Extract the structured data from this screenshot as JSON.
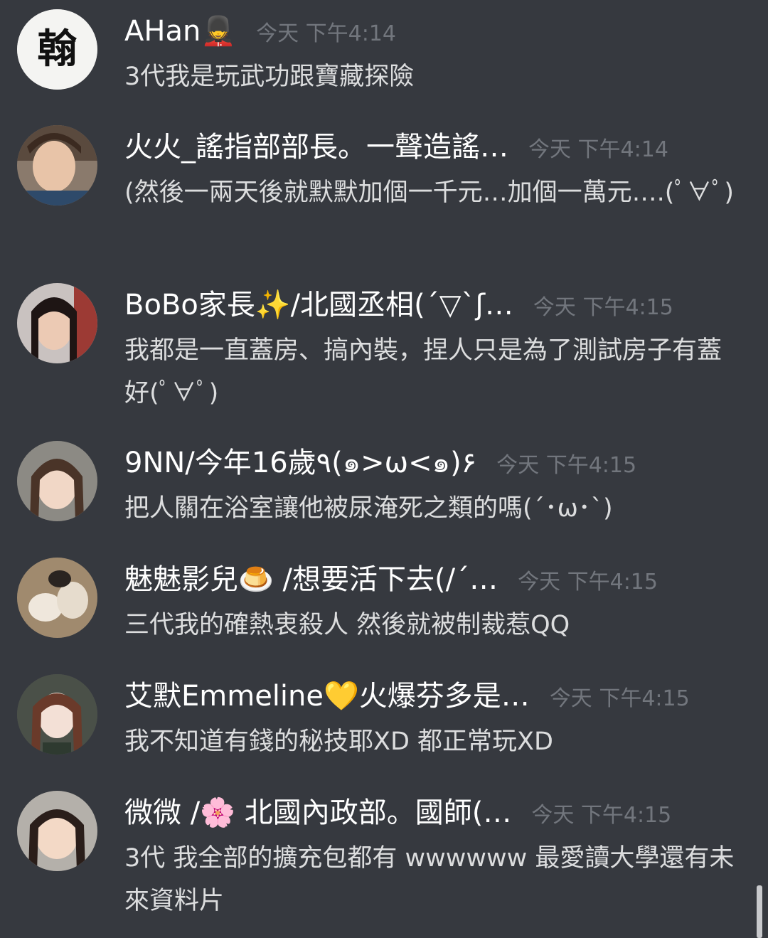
{
  "messages": [
    {
      "username": "AHan💂",
      "timestamp": "今天 下午4:14",
      "text": "3代我是玩武功跟寶藏探險",
      "avatar_icon": "calligraphy-avatar"
    },
    {
      "username": "火火_謠指部部長。一聲造謠…",
      "timestamp": "今天 下午4:14",
      "text": "(然後一兩天後就默默加個一千元…加個一萬元….(ﾟ∀ﾟ)",
      "avatar_icon": "photo-avatar"
    },
    {
      "username": "BoBo家長✨/北國丞相(´▽`ʃ…",
      "timestamp": "今天 下午4:15",
      "text": "我都是一直蓋房、搞內裝，捏人只是為了測試房子有蓋好(ﾟ∀ﾟ)",
      "avatar_icon": "photo-avatar"
    },
    {
      "username": "9NN/今年16歲٩(๑>ω<๑)۶",
      "timestamp": "今天 下午4:15",
      "text": "把人關在浴室讓他被尿淹死之類的嗎(´･ω･`)",
      "avatar_icon": "photo-avatar"
    },
    {
      "username": "魅魅影兒🍮 /想要活下去(/´…",
      "timestamp": "今天 下午4:15",
      "text": "三代我的確熱衷殺人 然後就被制裁惹QQ",
      "avatar_icon": "cats-photo-avatar"
    },
    {
      "username": "艾默Emmeline💛火爆芬多是…",
      "timestamp": "今天 下午4:15",
      "text": "我不知道有錢的秘技耶XD 都正常玩XD",
      "avatar_icon": "photo-avatar"
    },
    {
      "username": "微微 /🌸 北國內政部。國師(…",
      "timestamp": "今天 下午4:15",
      "text": "3代 我全部的擴充包都有 wwwwww 最愛讀大學還有未來資料片",
      "avatar_icon": "photo-avatar"
    }
  ],
  "colors": {
    "background": "#36393f",
    "username": "#ffffff",
    "timestamp": "#72767d",
    "text": "#dcddde"
  }
}
